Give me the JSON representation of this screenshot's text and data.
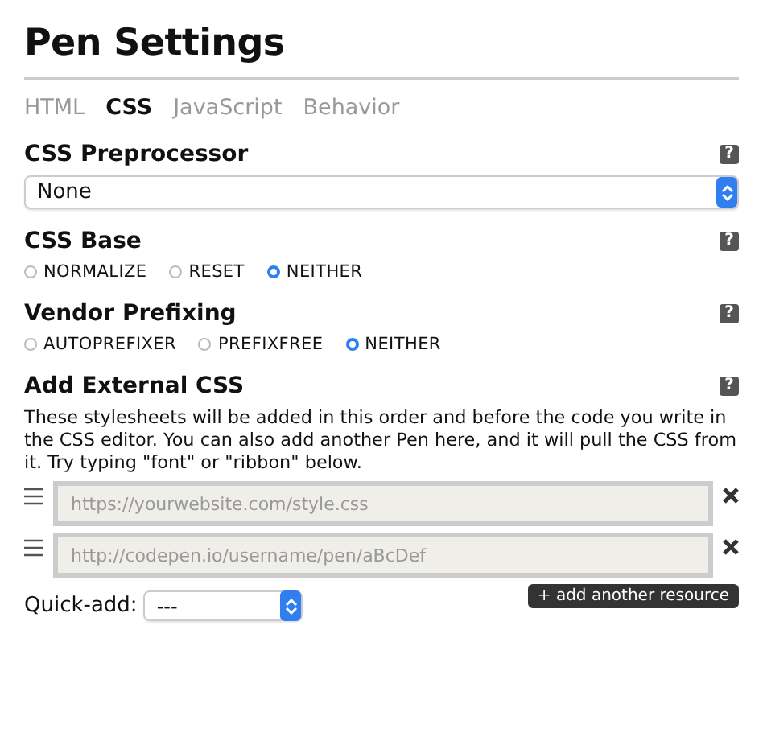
{
  "title": "Pen Settings",
  "tabs": [
    {
      "label": "HTML",
      "selected": false
    },
    {
      "label": "CSS",
      "selected": true
    },
    {
      "label": "JavaScript",
      "selected": false
    },
    {
      "label": "Behavior",
      "selected": false
    }
  ],
  "sections": [
    {
      "kind": "select",
      "heading": "CSS Preprocessor",
      "help": "?",
      "value": "None"
    },
    {
      "kind": "radios",
      "heading": "CSS Base",
      "help": "?",
      "options": [
        {
          "label": "NORMALIZE",
          "selected": false
        },
        {
          "label": "RESET",
          "selected": false
        },
        {
          "label": "NEITHER",
          "selected": true
        }
      ]
    },
    {
      "kind": "radios",
      "heading": "Vendor Prefixing",
      "help": "?",
      "options": [
        {
          "label": "AUTOPREFIXER",
          "selected": false
        },
        {
          "label": "PREFIXFREE",
          "selected": false
        },
        {
          "label": "NEITHER",
          "selected": true
        }
      ]
    },
    {
      "kind": "resources",
      "heading": "Add External CSS",
      "help": "?",
      "description": "These stylesheets will be added in this order and before the code you write in the CSS editor. You can also add another Pen here, and it will pull the CSS from it. Try typing \"font\" or \"ribbon\" below.",
      "resources": [
        {
          "placeholder": "https://yourwebsite.com/style.css"
        },
        {
          "placeholder": "http://codepen.io/username/pen/aBcDef"
        }
      ],
      "quick_add": {
        "label": "Quick-add:",
        "value": "---"
      },
      "add_button": "+ add another resource"
    }
  ]
}
